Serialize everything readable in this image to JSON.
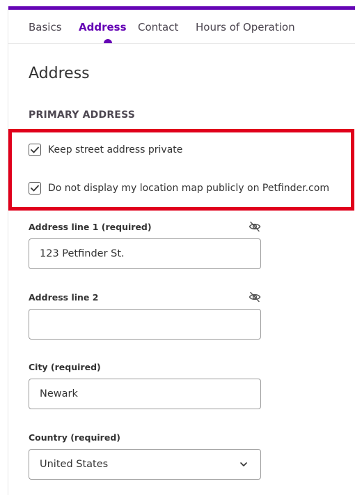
{
  "tabs": [
    {
      "label": "Basics"
    },
    {
      "label": "Address",
      "active": true
    },
    {
      "label": "Contact"
    },
    {
      "label": "Hours of Operation"
    }
  ],
  "page_title": "Address",
  "section_title": "PRIMARY ADDRESS",
  "checkboxes": [
    {
      "label": "Keep street address private",
      "checked": true
    },
    {
      "label": "Do not display my location map publicly on Petfinder.com",
      "checked": true
    }
  ],
  "fields": {
    "address1": {
      "label": "Address line 1 (required)",
      "value": "123 Petfinder St."
    },
    "address2": {
      "label": "Address line 2",
      "value": ""
    },
    "city": {
      "label": "City (required)",
      "value": "Newark"
    },
    "country": {
      "label": "Country (required)",
      "value": "United States"
    }
  },
  "colors": {
    "accent": "#6504b5",
    "highlight": "#e0001b"
  }
}
